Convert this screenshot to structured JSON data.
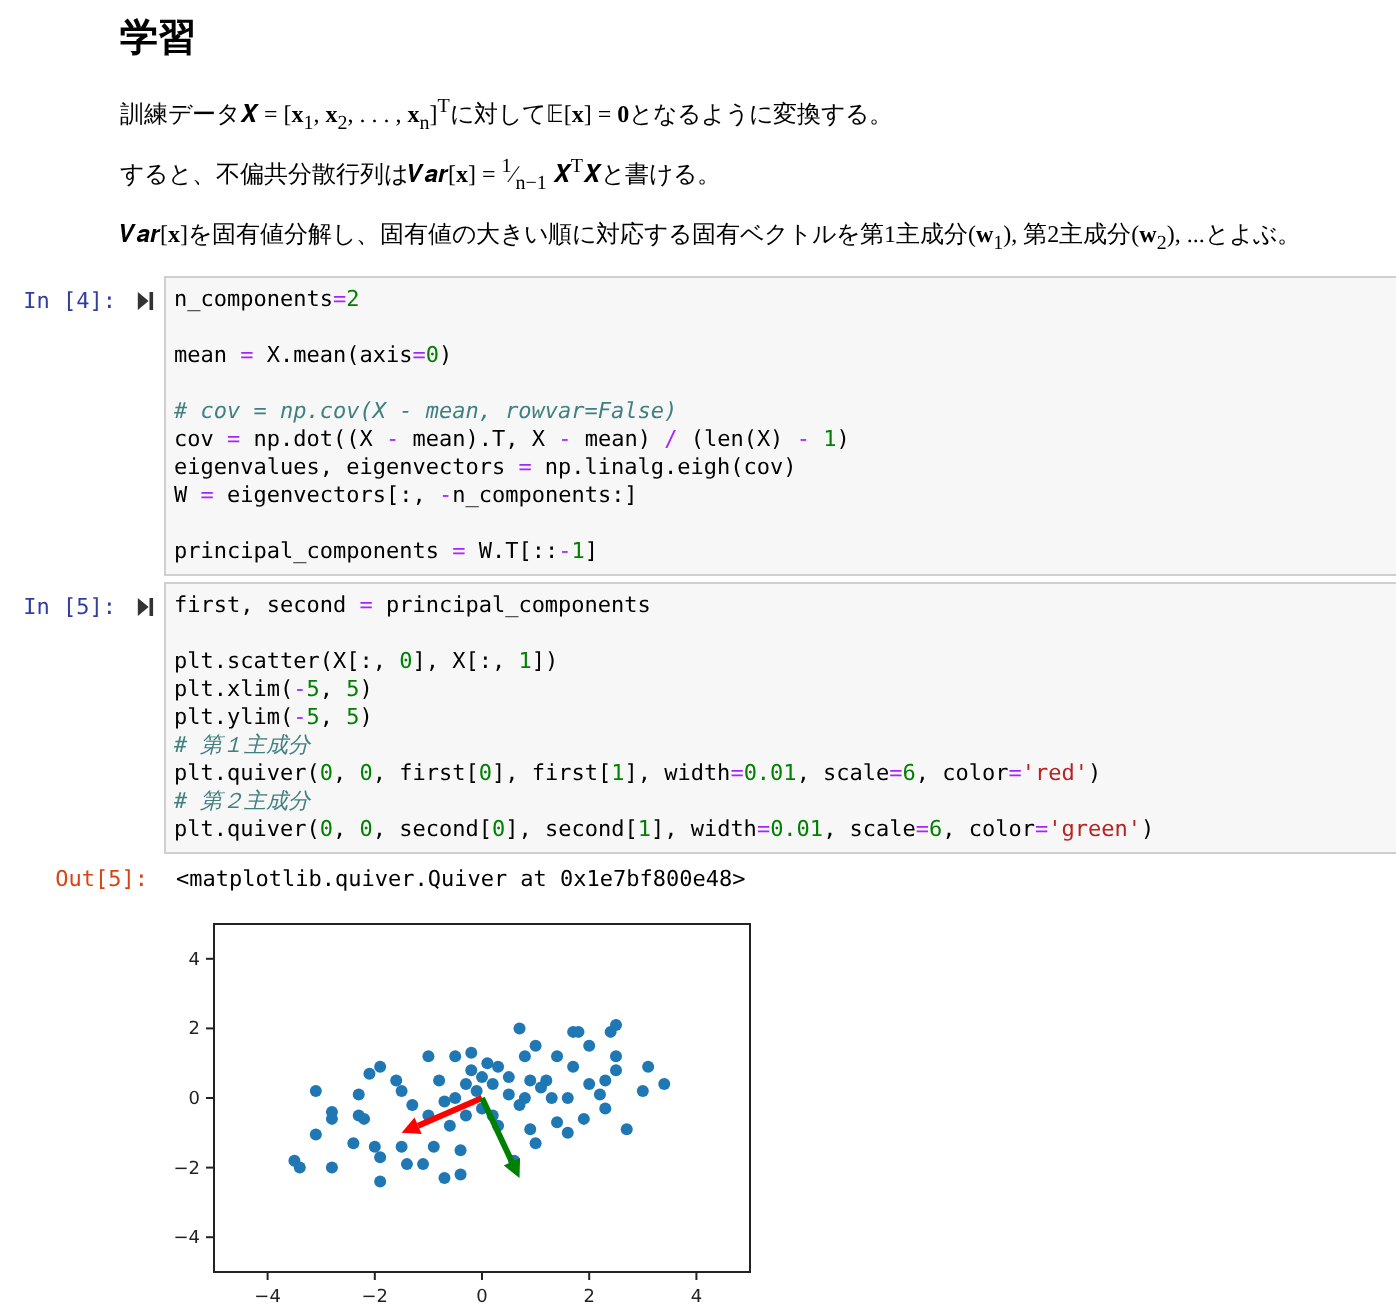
{
  "heading": "学習",
  "paragraphs": [
    "訓練データ𝑿 = [**x**$_{1}$, **x**$_{2}$, . . . , **x**$_{n}$]$^{T}$に対して𝔼[**x**] = **0**となるように変換する。",
    "すると、不偏共分散行列は𝑽𝒂𝒓[**x**] = $^{1}$⁄$_{n−1}$ 𝑿$^{T}$𝑿と書ける。",
    "𝑽𝒂𝒓[**x**]を固有値分解し、固有値の大きい順に対応する固有ベクトルを第1主成分(**w**$_{1}$), 第2主成分(**w**$_{2}$), ...とよぶ。"
  ],
  "cells": [
    {
      "prompt": "In [4]:",
      "source": "n_components=2\n\nmean = X.mean(axis=0)\n\n# cov = np.cov(X - mean, rowvar=False)\ncov = np.dot((X - mean).T, X - mean) / (len(X) - 1)\neigenvalues, eigenvectors = np.linalg.eigh(cov)\nW = eigenvectors[:, -n_components:]\n\nprincipal_components = W.T[::-1]"
    },
    {
      "prompt": "In [5]:",
      "source": "first, second = principal_components\n\nplt.scatter(X[:, 0], X[:, 1])\nplt.xlim(-5, 5)\nplt.ylim(-5, 5)\n# 第１主成分\nplt.quiver(0, 0, first[0], first[1], width=0.01, scale=6, color='red')\n# 第２主成分\nplt.quiver(0, 0, second[0], second[1], width=0.01, scale=6, color='green')",
      "out_prompt": "Out[5]:",
      "output": "<matplotlib.quiver.Quiver at 0x1e7bf800e48>",
      "chart_data": {
        "type": "scatter",
        "xlim": [
          -5,
          5
        ],
        "ylim": [
          -5,
          5
        ],
        "xticks": [
          {
            "value": -4,
            "label": "−4"
          },
          {
            "value": -2,
            "label": "−2"
          },
          0,
          2,
          4
        ],
        "yticks": [
          {
            "value": -4,
            "label": "−4"
          },
          {
            "value": -2,
            "label": "−2"
          },
          0,
          2,
          4
        ],
        "x": [
          -3.5,
          -3.4,
          -3.1,
          -3.1,
          -2.8,
          -2.8,
          -2.8,
          -2.4,
          -2.3,
          -2.3,
          -2.2,
          -2.1,
          -2.0,
          -1.9,
          -1.9,
          -1.9,
          -1.6,
          -1.5,
          -1.5,
          -1.4,
          -1.3,
          -1.1,
          -1.0,
          -1.0,
          -0.9,
          -0.8,
          -0.7,
          -0.7,
          -0.6,
          -0.5,
          -0.4,
          -0.4,
          -0.3,
          -0.3,
          -0.2,
          -0.2,
          -0.1,
          0.0,
          0.0,
          0.1,
          0.2,
          0.3,
          0.3,
          0.5,
          0.6,
          0.7,
          0.7,
          0.8,
          0.9,
          0.9,
          1.0,
          1.0,
          1.1,
          1.2,
          1.4,
          1.4,
          1.6,
          1.6,
          1.7,
          1.7,
          1.8,
          1.9,
          2.0,
          2.0,
          2.2,
          2.3,
          2.3,
          2.4,
          2.5,
          2.5,
          2.5,
          2.7,
          3.0,
          3.1,
          3.4,
          0.2,
          0.5,
          -0.5,
          0.8,
          1.3
        ],
        "series": [
          {
            "color": "#1f77b4",
            "values": [
              -1.8,
              -2.0,
              0.2,
              -1.05,
              -0.4,
              -0.6,
              -2.0,
              -1.3,
              0.1,
              -0.5,
              -0.6,
              0.7,
              -1.4,
              0.9,
              -1.7,
              -2.4,
              0.5,
              0.2,
              -1.4,
              -1.9,
              -0.2,
              -1.9,
              1.2,
              -0.5,
              -1.4,
              0.5,
              -0.1,
              -2.3,
              -0.8,
              1.2,
              -1.5,
              -2.2,
              0.4,
              -0.5,
              1.3,
              0.8,
              0.2,
              0.6,
              -0.3,
              1.0,
              0.4,
              0.9,
              -0.8,
              0.6,
              -1.8,
              2.0,
              -0.2,
              1.2,
              0.5,
              -0.9,
              1.5,
              -1.3,
              0.3,
              0.5,
              1.2,
              -0.7,
              0.0,
              -1.0,
              1.9,
              0.9,
              1.9,
              -0.6,
              1.5,
              0.4,
              0.1,
              -0.3,
              0.5,
              1.9,
              2.1,
              1.2,
              0.8,
              -0.9,
              0.2,
              0.9,
              0.4,
              -0.5,
              0.1,
              0.0,
              0.0,
              0.0
            ]
          }
        ]
      }
    }
  ]
}
